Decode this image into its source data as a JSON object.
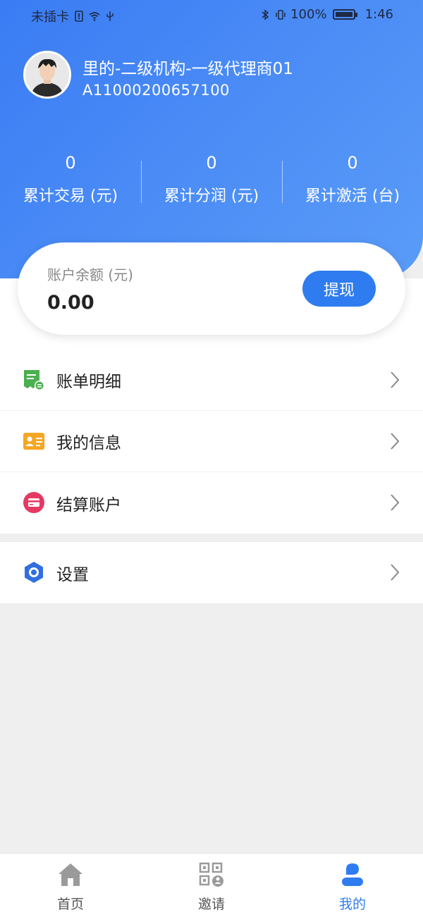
{
  "status_bar": {
    "carrier": "未插卡",
    "battery": "100%",
    "time": "1:46"
  },
  "profile": {
    "name": "里的-二级机构-一级代理商01",
    "id": "A11000200657100"
  },
  "stats": [
    {
      "value": "0",
      "label": "累计交易 (元)"
    },
    {
      "value": "0",
      "label": "累计分润 (元)"
    },
    {
      "value": "0",
      "label": "累计激活 (台)"
    }
  ],
  "balance": {
    "label": "账户余额 (元)",
    "value": "0.00",
    "withdraw_label": "提现"
  },
  "menu": {
    "items": [
      {
        "label": "账单明细",
        "icon": "bill-icon"
      },
      {
        "label": "我的信息",
        "icon": "id-card-icon"
      },
      {
        "label": "结算账户",
        "icon": "card-icon"
      }
    ],
    "settings": {
      "label": "设置",
      "icon": "settings-icon"
    }
  },
  "tabbar": {
    "tabs": [
      {
        "label": "首页",
        "icon": "home-icon"
      },
      {
        "label": "邀请",
        "icon": "qr-code-icon"
      },
      {
        "label": "我的",
        "icon": "user-icon",
        "active": true
      }
    ]
  },
  "colors": {
    "primary": "#2f7cf0",
    "header_gradient_start": "#3a7cf4",
    "header_gradient_end": "#5a9cf8",
    "bill_icon": "#4caf50",
    "id_card_icon": "#f5a623",
    "card_icon": "#e53962",
    "settings_icon": "#2f6fe0"
  }
}
